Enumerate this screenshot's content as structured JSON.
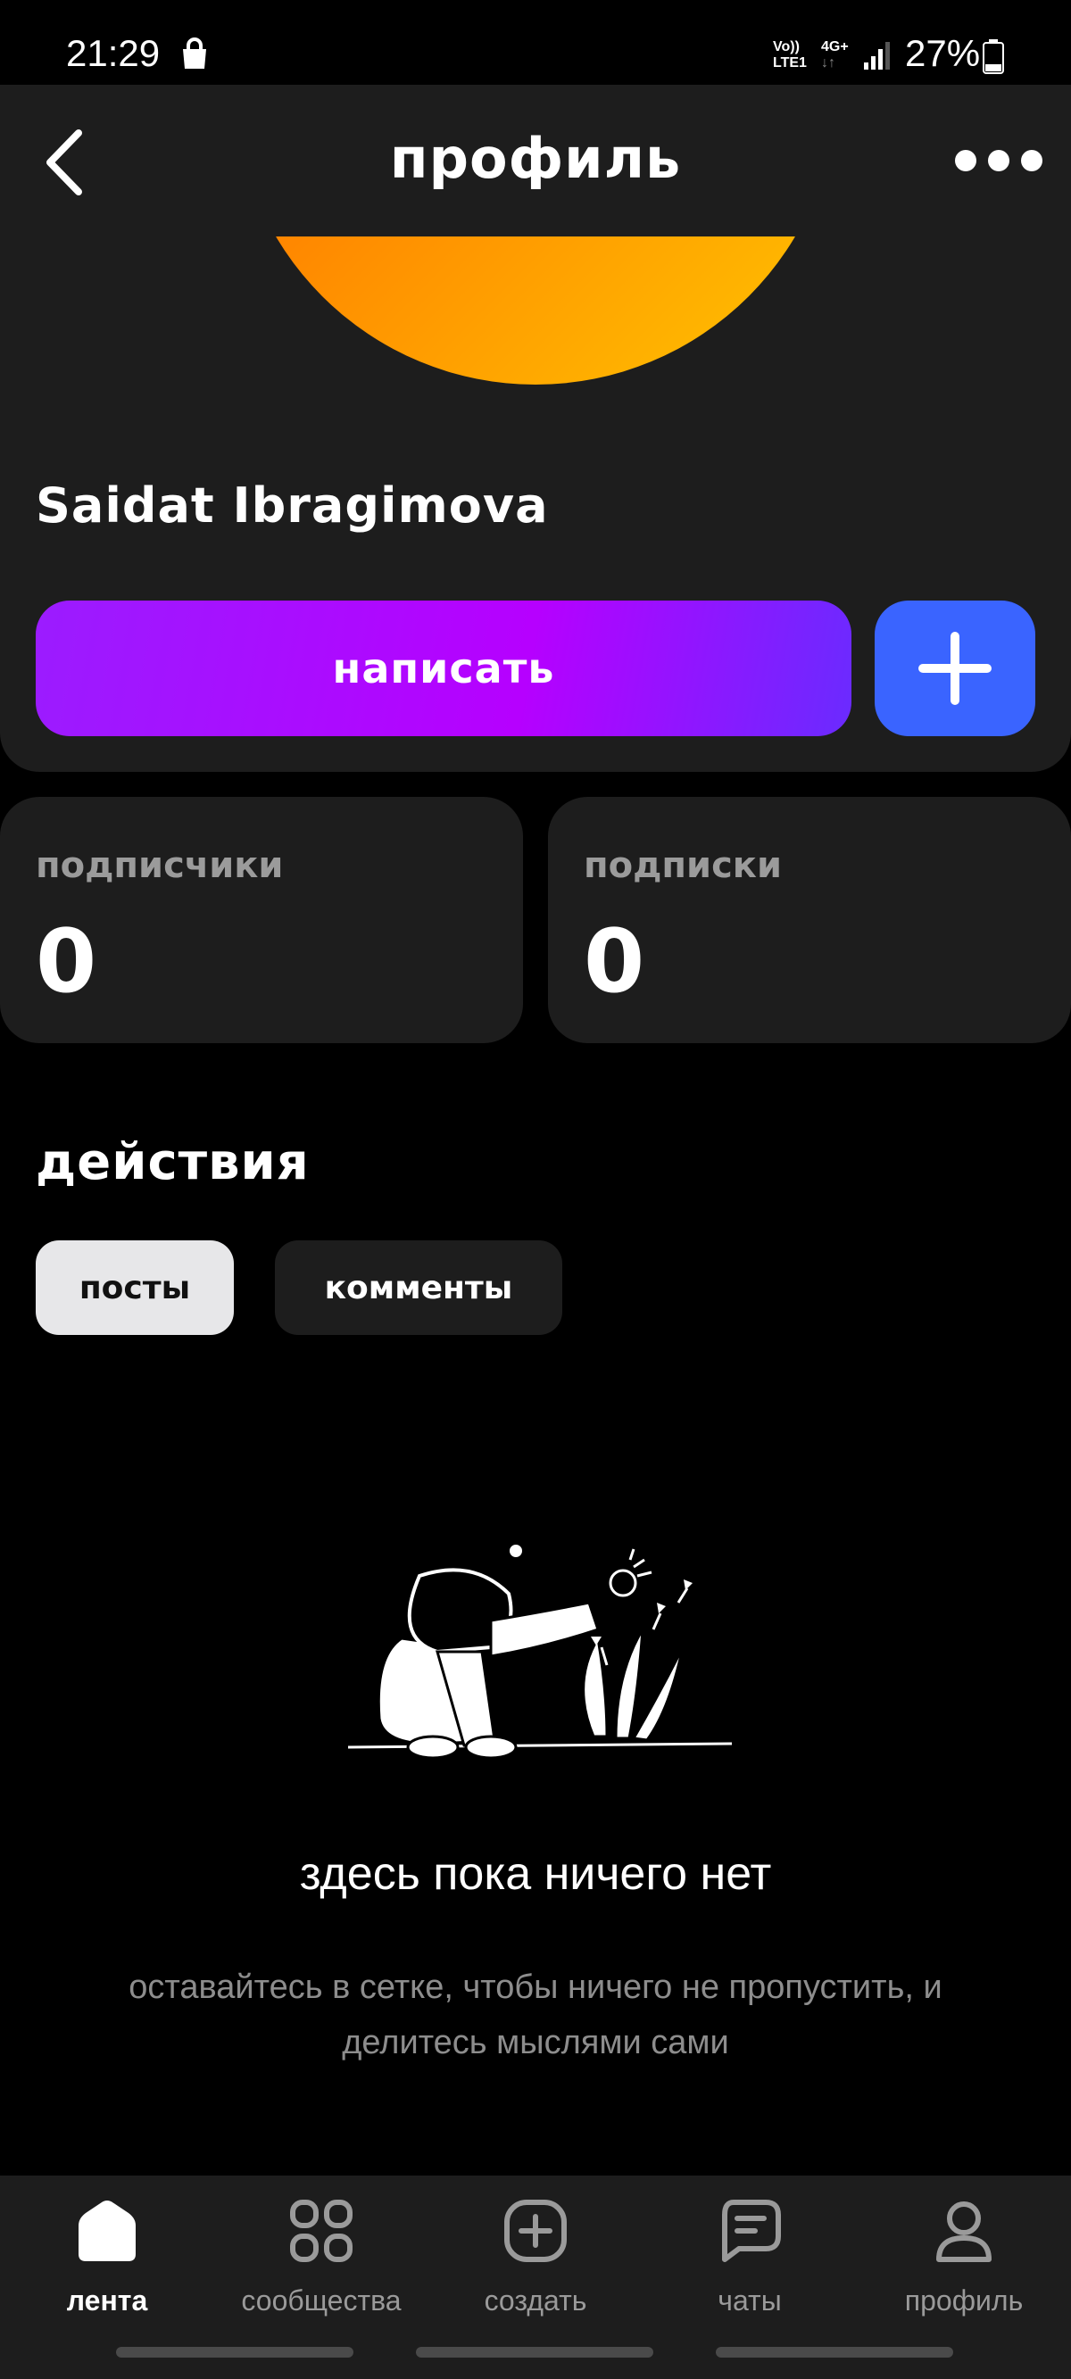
{
  "status_bar": {
    "time": "21:29",
    "network_top": "Vo))",
    "network_bottom": "LTE1",
    "data_type": "4G+",
    "battery_percent": "27%",
    "icons": [
      "shopping-bag-icon",
      "signal-icon",
      "battery-icon"
    ]
  },
  "header": {
    "title": "профиль",
    "back_icon": "chevron-left-icon",
    "more_icon": "more-horizontal-icon"
  },
  "profile": {
    "name": "Saidat Ibragimova",
    "write_button": "написать",
    "add_icon": "plus-icon",
    "avatar_colors": [
      "#ff5a00",
      "#ffc400"
    ]
  },
  "stats": [
    {
      "label": "подписчики",
      "value": "0"
    },
    {
      "label": "подписки",
      "value": "0"
    }
  ],
  "activity": {
    "title": "действия",
    "tabs": [
      {
        "label": "посты",
        "selected": true
      },
      {
        "label": "комменты",
        "selected": false
      }
    ]
  },
  "empty_state": {
    "title": "здесь пока ничего нет",
    "text": "оставайтесь в сетке, чтобы ничего не пропустить, и делитесь мыслями сами"
  },
  "bottom_nav": [
    {
      "label": "лента",
      "icon": "home-icon",
      "active": true
    },
    {
      "label": "сообщества",
      "icon": "grid-icon",
      "active": false
    },
    {
      "label": "создать",
      "icon": "create-plus-icon",
      "active": false
    },
    {
      "label": "чаты",
      "icon": "chat-icon",
      "active": false
    },
    {
      "label": "профиль",
      "icon": "user-icon",
      "active": false
    }
  ],
  "colors": {
    "accent_purple": "#b600ff",
    "accent_blue": "#3a64ff",
    "card": "#1d1d1d",
    "background": "#000000"
  }
}
